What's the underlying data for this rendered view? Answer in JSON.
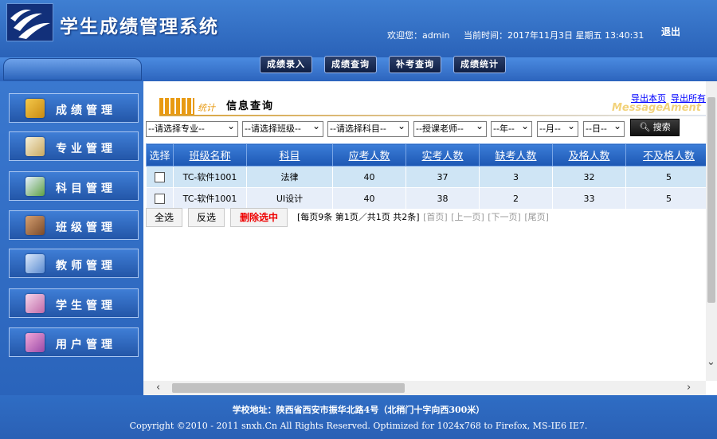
{
  "header": {
    "app_title": "学生成绩管理系统",
    "welcome": "欢迎您：admin",
    "current_time": "当前时间：2017年11月3日 星期五 13:40:31",
    "logout_label": "退出"
  },
  "top_nav": {
    "tabs": [
      "成绩录入",
      "成绩查询",
      "补考查询",
      "成绩统计"
    ]
  },
  "sidebar": {
    "items": [
      {
        "label": "成绩管理",
        "icon": "folder-lock-icon"
      },
      {
        "label": "专业管理",
        "icon": "document-search-icon"
      },
      {
        "label": "科目管理",
        "icon": "edit-document-icon"
      },
      {
        "label": "班级管理",
        "icon": "classroom-icon"
      },
      {
        "label": "教师管理",
        "icon": "teacher-icon"
      },
      {
        "label": "学生管理",
        "icon": "student-icon"
      },
      {
        "label": "用户管理",
        "icon": "user-icon"
      }
    ]
  },
  "main": {
    "title_sub": "统计",
    "title": "信息查询",
    "export_page": "导出本页",
    "export_all": "导出所有",
    "watermark": "MessageAment",
    "filters": {
      "major": "--请选择专业--",
      "class": "--请选择班级--",
      "subject": "--请选择科目--",
      "teacher": "--授课老师--",
      "year": "--年--",
      "month": "--月--",
      "day": "--日--"
    },
    "search_label": "搜索",
    "table": {
      "headers": [
        "选择",
        "班级名称",
        "科目",
        "应考人数",
        "实考人数",
        "缺考人数",
        "及格人数",
        "不及格人数"
      ],
      "rows": [
        [
          "TC-软件1001",
          "法律",
          "40",
          "37",
          "3",
          "32",
          "5"
        ],
        [
          "TC-软件1001",
          "UI设计",
          "40",
          "38",
          "2",
          "33",
          "5"
        ]
      ]
    },
    "buttons": {
      "select_all": "全选",
      "invert": "反选",
      "delete_selected": "删除选中"
    },
    "pager": {
      "info": "[每页9条 第1页／共1页 共2条]",
      "first": "[首页]",
      "prev": "[上一页]",
      "next": "[下一页]",
      "last": "[尾页]"
    }
  },
  "footer": {
    "address": "学校地址：陕西省西安市振华北路4号（北稍门十字向西300米）",
    "copyright": "Copyright ©2010 - 2011 snxh.Cn All Rights Reserved. Optimized for 1024x768 to Firefox, MS-IE6 IE7."
  },
  "colors": {
    "brand_blue": "#2f6bc0",
    "header_cell": "#1d57b3",
    "row_a": "#cfe5f5",
    "row_b": "#e7eef9",
    "accent_orange": "#e89a12"
  }
}
